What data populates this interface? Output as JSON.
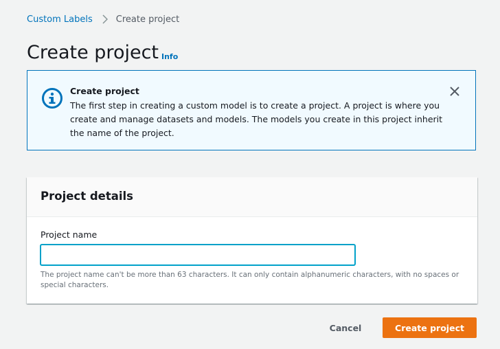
{
  "breadcrumb": {
    "items": [
      {
        "label": "Custom Labels"
      },
      {
        "label": "Create project"
      }
    ]
  },
  "header": {
    "title": "Create project",
    "info_label": "Info"
  },
  "alert": {
    "title": "Create project",
    "body": "The first step in creating a custom model is to create a project. A project is where you create and manage datasets and models. The models you create in this project inherit the name of the project.",
    "icon": "info-icon"
  },
  "project_details": {
    "title": "Project details",
    "name_label": "Project name",
    "name_value": "",
    "hint": "The project name can't be more than 63 characters. It can only contain alphanumeric characters, with no spaces or special characters."
  },
  "actions": {
    "cancel_label": "Cancel",
    "create_label": "Create project"
  },
  "colors": {
    "link": "#0073bb",
    "primary_button": "#ec7211",
    "alert_background": "#f1faff",
    "alert_border": "#0073bb",
    "input_focus": "#00a1c9"
  }
}
